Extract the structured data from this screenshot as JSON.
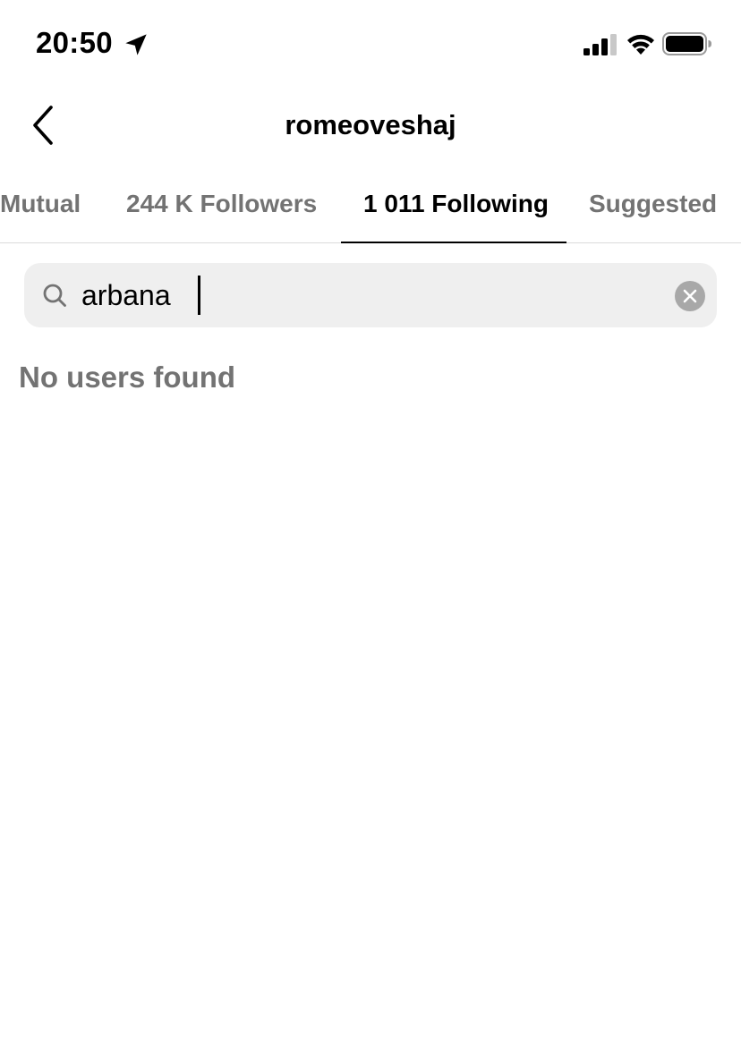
{
  "status_bar": {
    "time": "20:50",
    "icons": [
      "location-arrow-icon",
      "cellular-signal-icon",
      "wifi-icon",
      "battery-icon"
    ]
  },
  "header": {
    "title": "romeoveshaj",
    "back_icon": "chevron-left-icon"
  },
  "tabs": [
    {
      "label": "Mutual",
      "active": false
    },
    {
      "label": "244 K Followers",
      "active": false
    },
    {
      "label": "1 011 Following",
      "active": true
    },
    {
      "label": "Suggested",
      "active": false
    }
  ],
  "search": {
    "value": "arbana",
    "icon": "search-icon",
    "clear_icon": "clear-icon"
  },
  "results": {
    "empty_message": "No users found"
  },
  "colors": {
    "background": "#ffffff",
    "text_primary": "#000000",
    "text_secondary": "#737373",
    "search_bg": "#efefef",
    "divider": "#dbdbdb",
    "clear_button": "#a8a8a8"
  }
}
